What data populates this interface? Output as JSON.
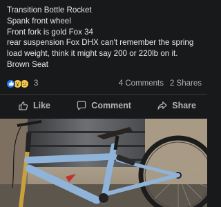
{
  "post": {
    "lines": [
      "Transition Bottle Rocket",
      "Spank front wheel",
      "Front fork is gold Fox 34",
      "rear suspension Fox DHX can't remember the spring load weight, think it might say 200 or 220lb on it.",
      "Brown Seat"
    ]
  },
  "reactions": {
    "icons": [
      "like-reaction",
      "wow-reaction",
      "sad-reaction"
    ],
    "count": "3",
    "comments": "4 Comments",
    "shares": "2 Shares"
  },
  "actions": {
    "like": "Like",
    "comment": "Comment",
    "share": "Share"
  },
  "colors": {
    "background": "#18191a",
    "text": "#e4e6eb",
    "secondary_text": "#b0b3b8",
    "like_blue": "#2078f4",
    "bike_frame": "#8fb3d9"
  }
}
